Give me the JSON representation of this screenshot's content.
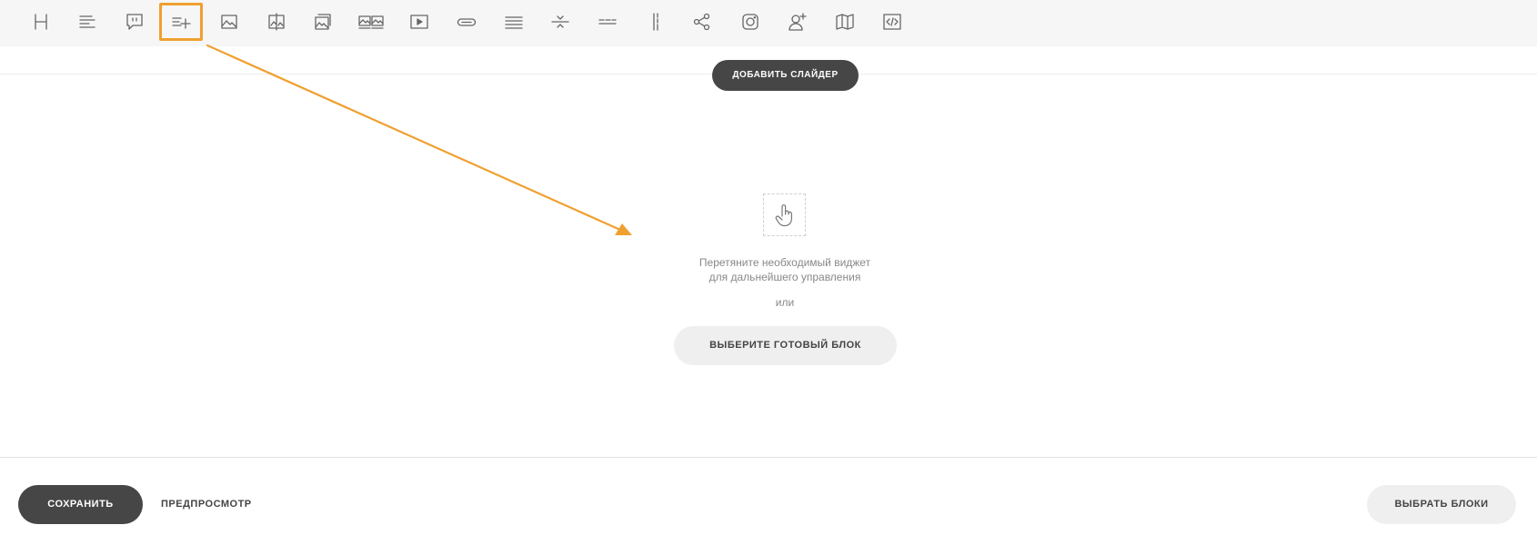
{
  "toolbar": {
    "tools": [
      {
        "icon": "heading-icon"
      },
      {
        "icon": "text-icon"
      },
      {
        "icon": "quote-icon"
      },
      {
        "icon": "add-list-icon",
        "active": true
      },
      {
        "icon": "image-icon"
      },
      {
        "icon": "image-compare-icon"
      },
      {
        "icon": "gallery-icon"
      },
      {
        "icon": "image-grid-icon"
      },
      {
        "icon": "video-icon"
      },
      {
        "icon": "button-icon"
      },
      {
        "icon": "lines-icon"
      },
      {
        "icon": "spacer-icon"
      },
      {
        "icon": "divider-icon"
      },
      {
        "icon": "vertical-divider-icon"
      },
      {
        "icon": "share-icon"
      },
      {
        "icon": "instagram-icon"
      },
      {
        "icon": "add-user-icon"
      },
      {
        "icon": "map-icon"
      },
      {
        "icon": "code-icon"
      }
    ],
    "highlight_color": "#f0a030"
  },
  "slider": {
    "add_label": "ДОБАВИТЬ СЛАЙДЕР"
  },
  "dropzone": {
    "icon": "hand-pointer-icon",
    "hint_line1": "Перетяните необходимый виджет",
    "hint_line2": "для дальнейшего управления",
    "or_label": "или",
    "choose_block_label": "ВЫБЕРИТЕ ГОТОВЫЙ БЛОК"
  },
  "footer": {
    "save_label": "СОХРАНИТЬ",
    "preview_label": "ПРЕДПРОСМОТР",
    "pick_blocks_label": "ВЫБРАТЬ БЛОКИ"
  },
  "colors": {
    "dark_button": "#464646",
    "light_button": "#efefef",
    "toolbar_bg": "#f6f6f6",
    "annotation_arrow": "#f0a030"
  }
}
